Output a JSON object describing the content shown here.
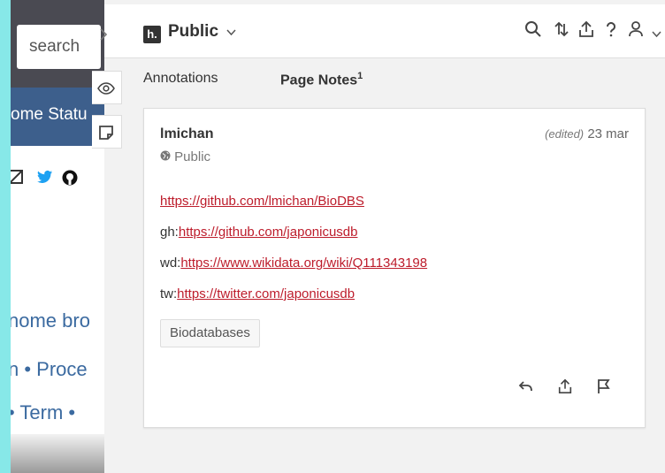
{
  "background_page": {
    "search_placeholder": "search",
    "nav_text": "ome Statu",
    "text_line_1": "nome bro",
    "text_line_2": "n • Proce",
    "text_line_3": "• Term •"
  },
  "topbar": {
    "logo_letter": "h.",
    "group_name": "Public",
    "chevron": "⌄"
  },
  "tabs": {
    "annotations_label": "Annotations",
    "page_notes_label": "Page Notes",
    "page_notes_count": "1"
  },
  "note": {
    "user": "lmichan",
    "edited_label": "(edited)",
    "date": "23 mar",
    "visibility": "Public",
    "lines": [
      {
        "prefix": "",
        "link": "https://github.com/lmichan/BioDBS"
      },
      {
        "prefix": "gh:",
        "link": "https://github.com/japonicusdb"
      },
      {
        "prefix": "wd:",
        "link": "https://www.wikidata.org/wiki/Q111343198"
      },
      {
        "prefix": "tw:",
        "link": "https://twitter.com/japonicusdb"
      }
    ],
    "tag": "Biodatabases"
  },
  "colors": {
    "link": "#bd1c2b",
    "outer_background": "#87e8e8",
    "sidebar_background": "#f2f2f2"
  }
}
